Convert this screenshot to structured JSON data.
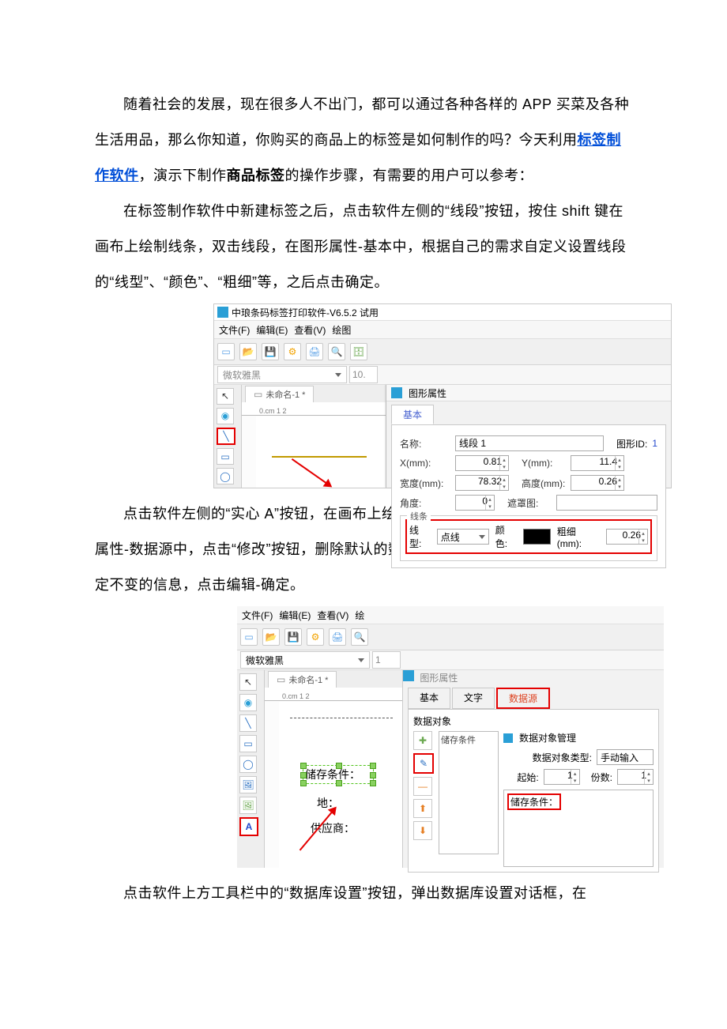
{
  "paragraphs": {
    "p1_a": "随着社会的发展，现在很多人不出门，都可以通过各种各样的 APP 买菜及各种生活用品，那么你知道，你购买的商品上的标签是如何制作的吗？今天利用",
    "p1_link": "标签制作软件",
    "p1_b": "，演示下制作",
    "p1_bold": "商品标签",
    "p1_c": "的操作步骤，有需要的用户可以参考：",
    "p2": "在标签制作软件中新建标签之后，点击软件左侧的“线段”按钮，按住 shift 键在画布上绘制线条，双击线段，在图形属性-基本中，根据自己的需求自定义设置线段的“线型”、“颜色”、“粗细”等，之后点击确定。",
    "p3": "点击软件左侧的“实心 A”按钮，在画布上绘制普通文本，双击普通文本，在图形属性-数据源中，点击“修改”按钮，删除默认的数据，在下面的状态框中手动输入固定不变的信息，点击编辑-确定。",
    "p4": "点击软件上方工具栏中的“数据库设置”按钮，弹出数据库设置对话框，在"
  },
  "app1": {
    "title": "中琅条码标签打印软件-V6.5.2 试用",
    "menus": [
      "文件(F)",
      "编辑(E)",
      "查看(V)",
      "绘图"
    ],
    "font": "微软雅黑",
    "fontsize": "10.",
    "doc_tab": "未命名-1 *",
    "ruler": "0.cm    1        2",
    "dialog_title": "图形属性",
    "tab_basic": "基本",
    "lbl_name": "名称:",
    "val_name": "线段 1",
    "lbl_gid": "图形ID:",
    "val_gid": "1",
    "lbl_x": "X(mm):",
    "val_x": "0.81",
    "lbl_y": "Y(mm):",
    "val_y": "11.4",
    "lbl_w": "宽度(mm):",
    "val_w": "78.32",
    "lbl_h": "高度(mm):",
    "val_h": "0.26",
    "lbl_angle": "角度:",
    "val_angle": "0",
    "lbl_mask": "遮罩图:",
    "group_line": "线条",
    "lbl_ltype": "线型:",
    "val_ltype": "点线",
    "lbl_color": "颜色:",
    "lbl_thick": "粗细(mm):",
    "val_thick": "0.26"
  },
  "app2": {
    "menus": [
      "文件(F)",
      "编辑(E)",
      "查看(V)",
      "绘"
    ],
    "font": "微软雅黑",
    "fontsize": "1",
    "doc_tab": "未命名-1 *",
    "ruler": "0.cm    1        2",
    "dialog_title": "图形属性",
    "tab_basic": "基本",
    "tab_text": "文字",
    "tab_data": "数据源",
    "lbl_obj": "数据对象",
    "list_item": "储存条件",
    "panel_title": "数据对象管理",
    "lbl_type": "数据对象类型:",
    "val_type": "手动输入",
    "lbl_start": "起始:",
    "val_start": "1",
    "lbl_count": "份数:",
    "val_count": "1",
    "area_label": "储存条件：",
    "canvas_sel": "储存条件：",
    "canvas_l2": "地：",
    "canvas_l3": "供应商："
  }
}
